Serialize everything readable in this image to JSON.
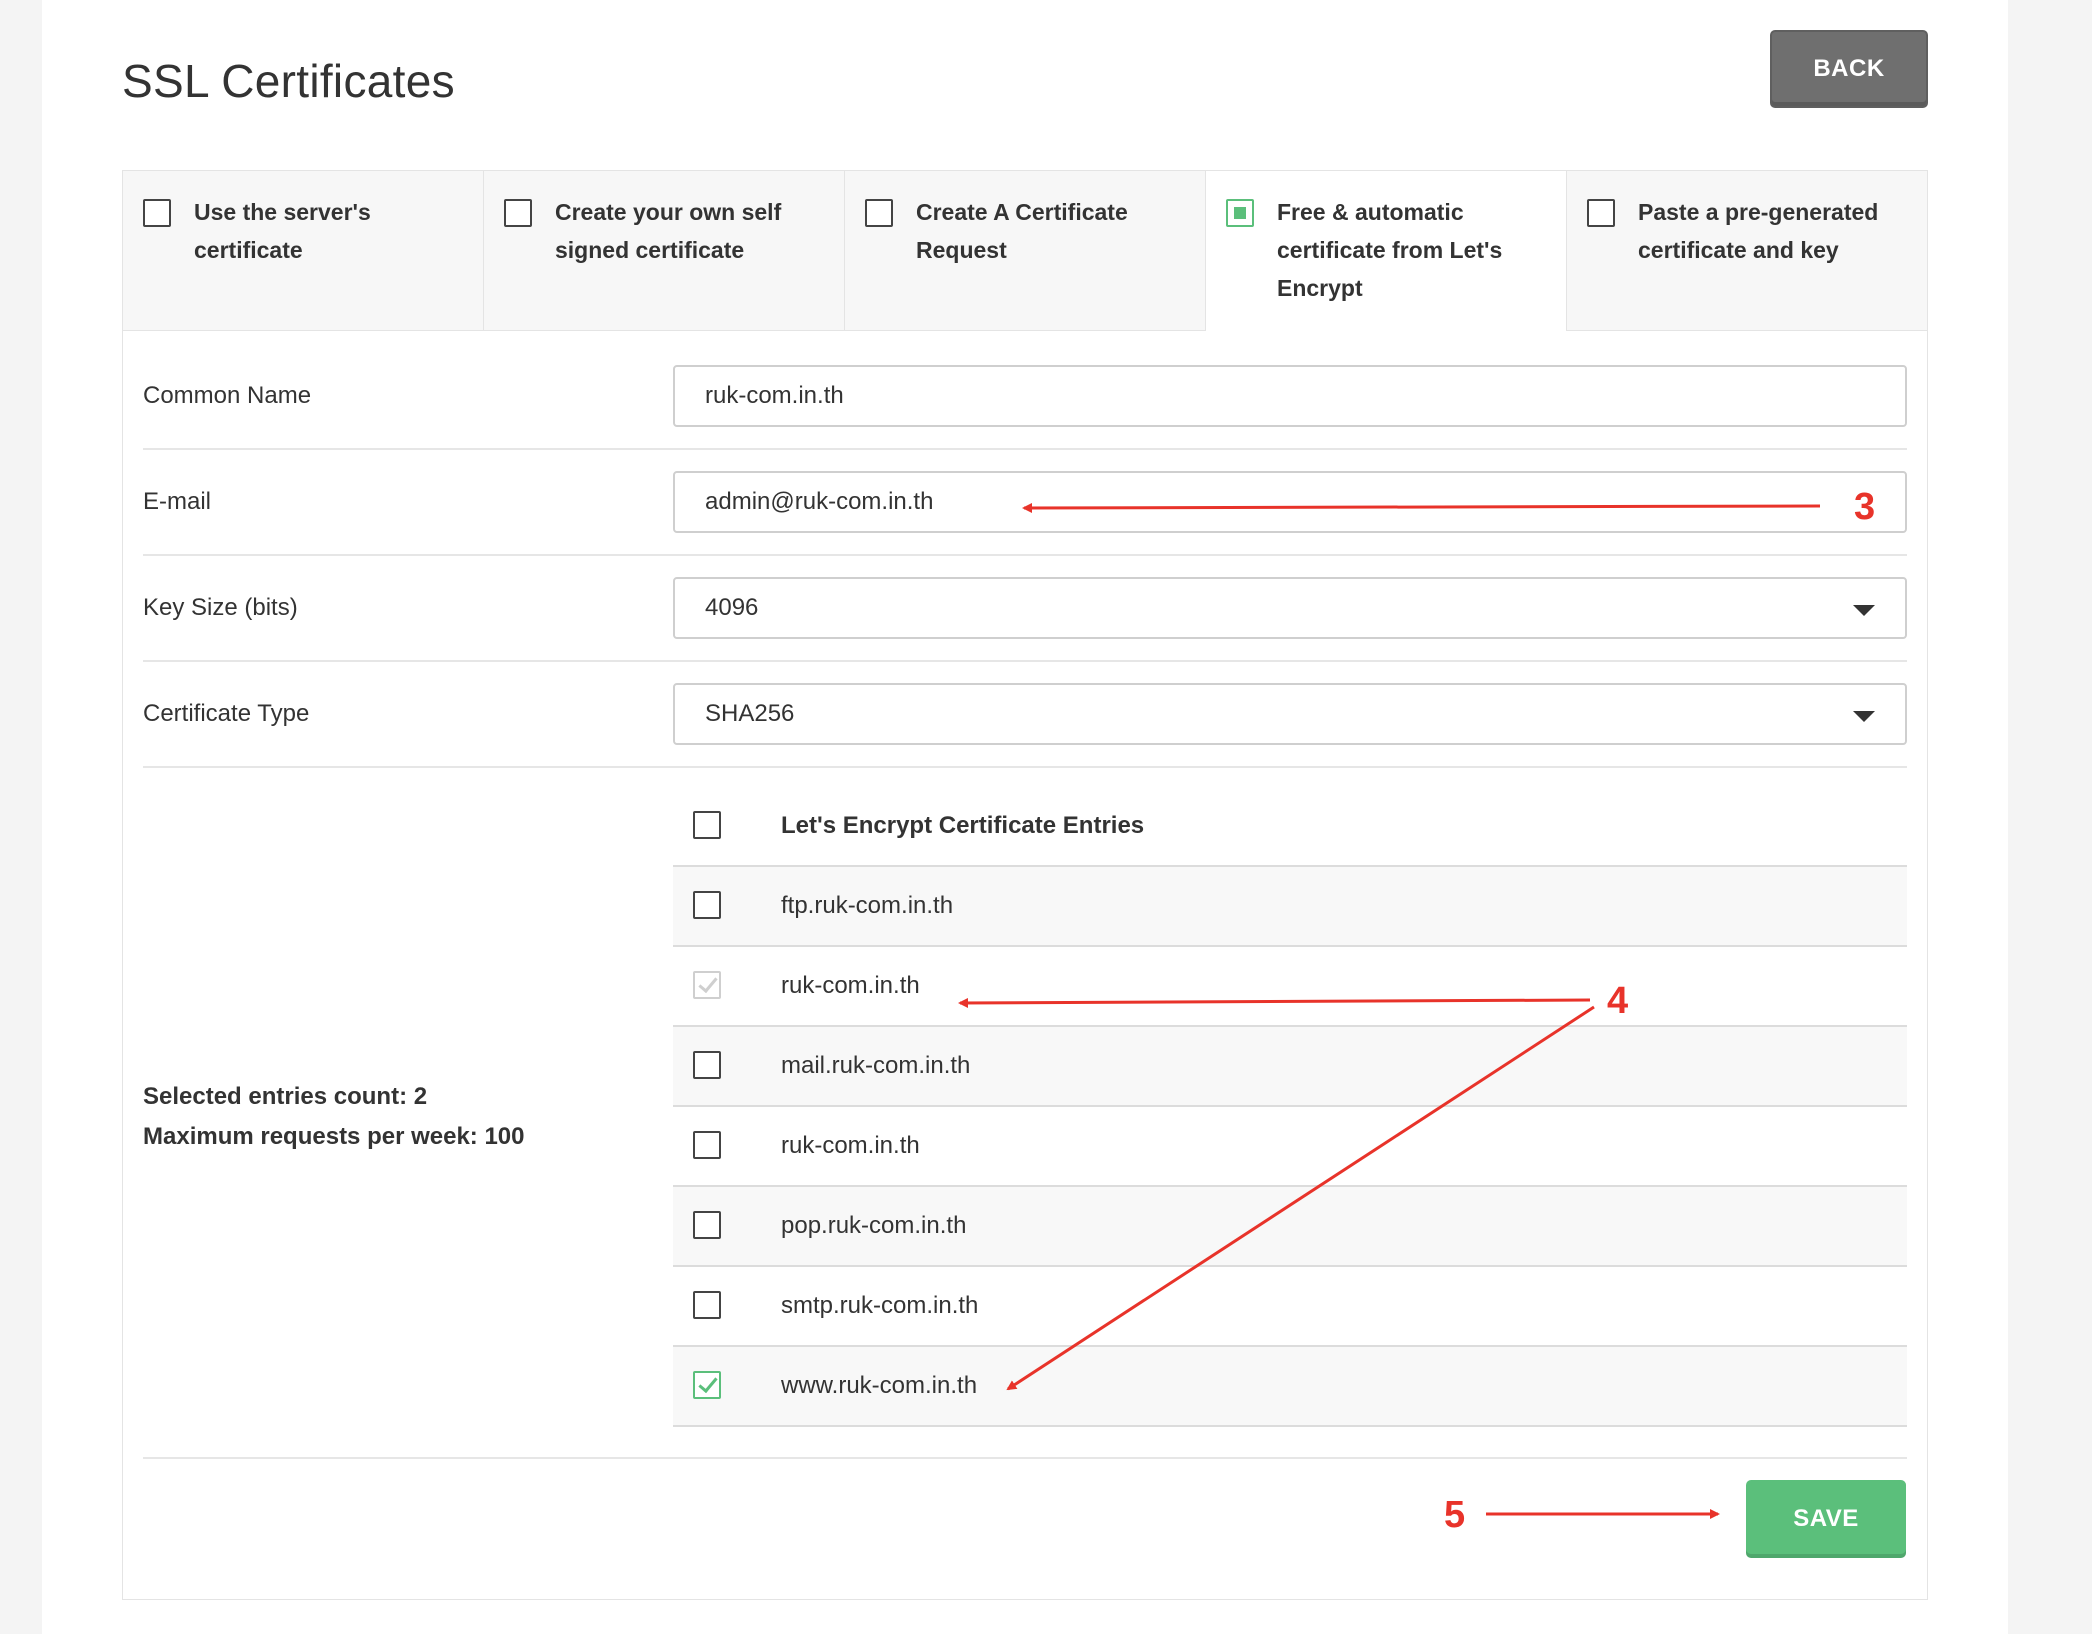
{
  "page": {
    "title": "SSL Certificates",
    "back_label": "BACK",
    "save_label": "SAVE"
  },
  "tabs": [
    {
      "label": "Use the server's certificate",
      "state": "unchecked",
      "active": false
    },
    {
      "label": "Create your own self signed certificate",
      "state": "unchecked",
      "active": false
    },
    {
      "label": "Create A Certificate Request",
      "state": "unchecked",
      "active": false
    },
    {
      "label": "Free & automatic certificate from Let's Encrypt",
      "state": "partial",
      "active": true
    },
    {
      "label": "Paste a pre-generated certificate and key",
      "state": "unchecked",
      "active": false
    }
  ],
  "form": {
    "common_name": {
      "label": "Common Name",
      "value": "ruk-com.in.th"
    },
    "email": {
      "label": "E-mail",
      "value": "admin@ruk-com.in.th"
    },
    "key_size": {
      "label": "Key Size (bits)",
      "value": "4096"
    },
    "cert_type": {
      "label": "Certificate Type",
      "value": "SHA256"
    }
  },
  "entries": {
    "header": "Let's Encrypt Certificate Entries",
    "selected_count": "Selected entries count: 2",
    "max_requests": "Maximum requests per week: 100",
    "items": [
      {
        "name": "ftp.ruk-com.in.th",
        "state": "unchecked"
      },
      {
        "name": "ruk-com.in.th",
        "state": "disabled"
      },
      {
        "name": "mail.ruk-com.in.th",
        "state": "unchecked"
      },
      {
        "name": "ruk-com.in.th",
        "state": "unchecked"
      },
      {
        "name": "pop.ruk-com.in.th",
        "state": "unchecked"
      },
      {
        "name": "smtp.ruk-com.in.th",
        "state": "unchecked"
      },
      {
        "name": "www.ruk-com.in.th",
        "state": "checked"
      }
    ]
  },
  "annotations": {
    "step3": "3",
    "step4": "4",
    "step5": "5",
    "color": "#e8332a"
  },
  "colors": {
    "accent_green": "#5bbf7b",
    "back_button": "#6f6f6f"
  }
}
